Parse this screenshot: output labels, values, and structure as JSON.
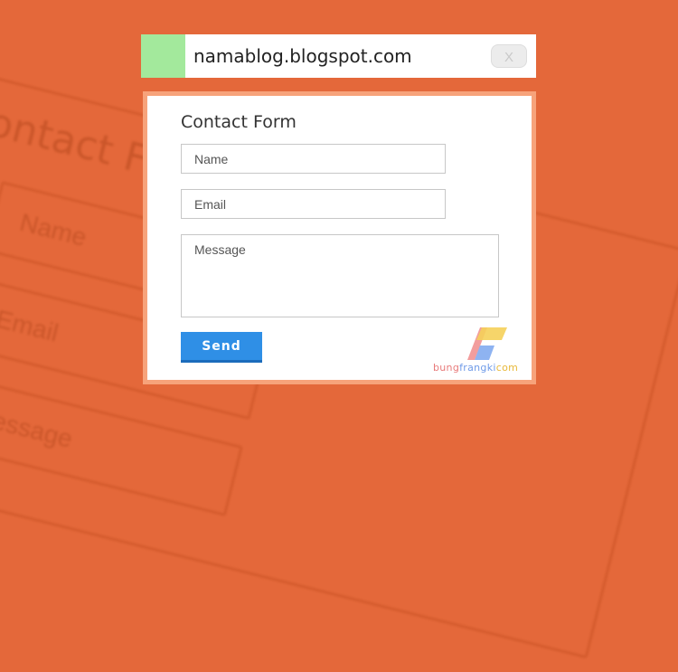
{
  "header": {
    "site_url": "namablog.blogspot.com",
    "close_label": "X",
    "swatch_color": "#a3e99c"
  },
  "form": {
    "title": "Contact Form",
    "name_placeholder": "Name",
    "email_placeholder": "Email",
    "message_placeholder": "Message",
    "send_label": "Send",
    "send_color": "#2f8fe6",
    "border_color": "#f7a37b"
  },
  "background": {
    "title": "Contact Form",
    "field_name": "Name",
    "field_email": "Email",
    "field_message": "Message",
    "color": "#e4683a"
  },
  "watermark": {
    "part1": "bung",
    "part2": "frangki",
    "part3": "com"
  }
}
